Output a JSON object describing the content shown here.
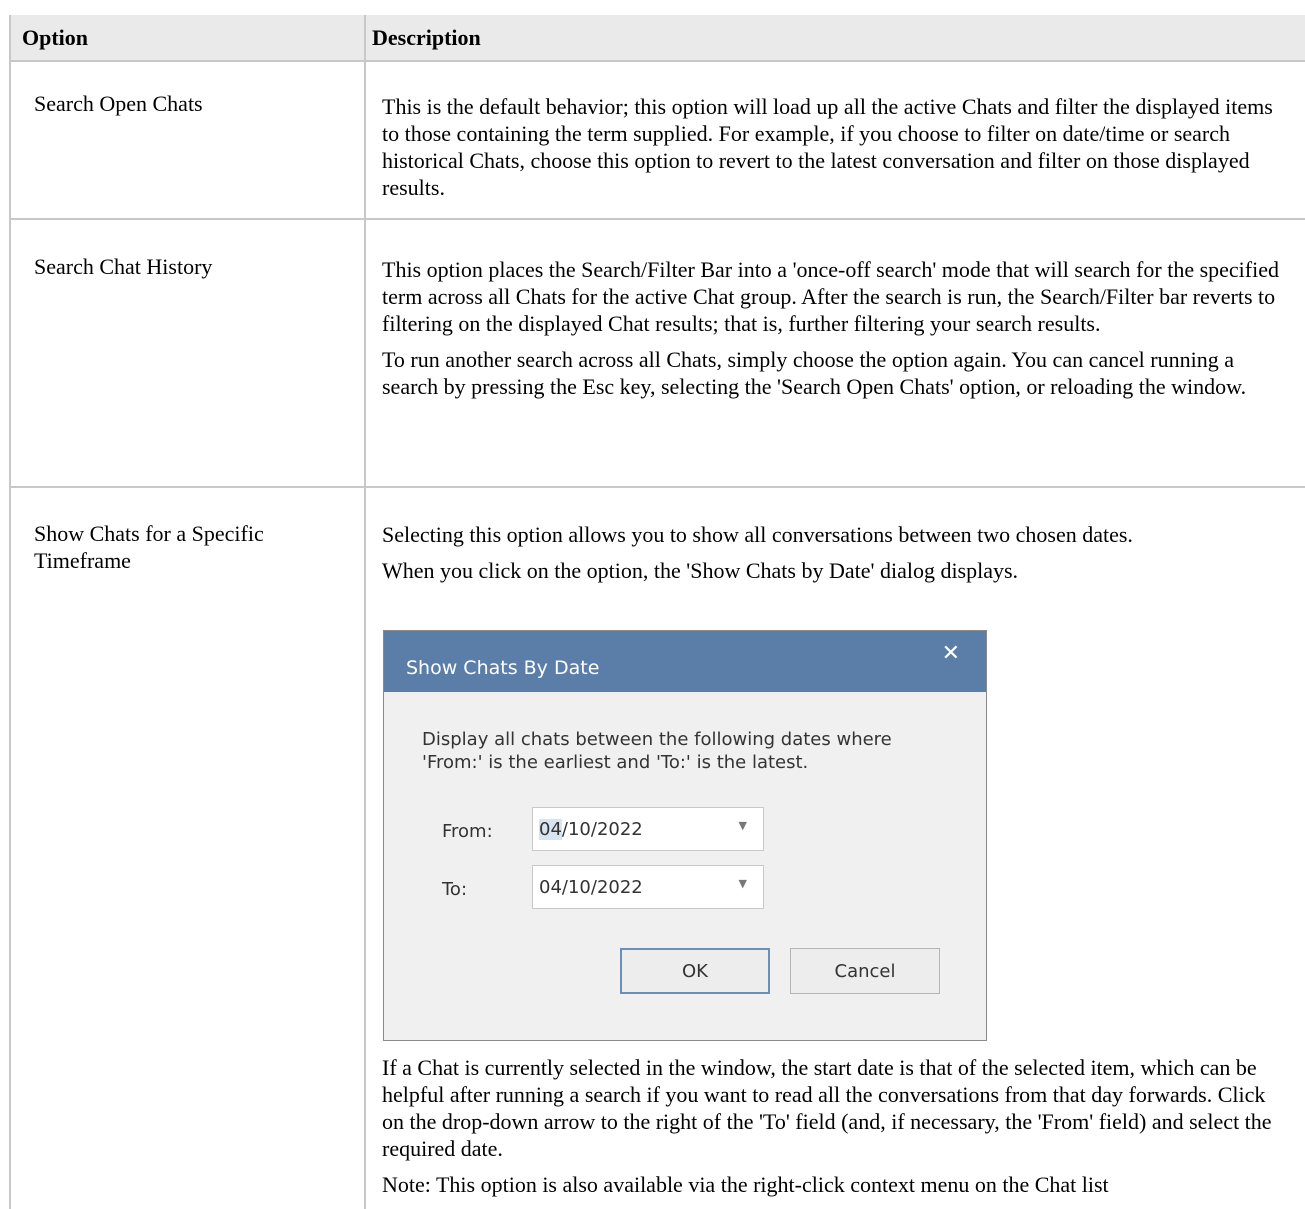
{
  "table": {
    "headers": {
      "option": "Option",
      "description": "Description"
    },
    "rows": [
      {
        "option": "Search Open Chats",
        "paragraphs": [
          "This is the default behavior; this option will load up all the active Chats and filter the displayed items to those containing the term supplied. For example, if you choose to filter on date/time or search historical Chats, choose this option to revert to the latest conversation and filter on those displayed results."
        ]
      },
      {
        "option": "Search Chat History",
        "paragraphs": [
          "This option places the Search/Filter Bar into a 'once-off search' mode that will search for the specified term across all Chats for the active Chat group. After the search is run, the Search/Filter bar reverts to filtering on the displayed Chat results; that is, further filtering your search results.",
          "To run another search across all Chats, simply choose the option again. You can cancel running a search by pressing the Esc key, selecting the 'Search Open Chats' option, or reloading the window."
        ]
      },
      {
        "option": "Show Chats for a Specific Timeframe",
        "paragraphs": [
          "Selecting this option allows you to show all conversations between two chosen dates.",
          "When you click on the option, the 'Show Chats by Date' dialog displays.",
          "If a Chat is currently selected in the window, the start date is that of the selected item, which can be helpful after running a search if you want to read all the conversations from that day forwards. Click on the drop-down arrow to the right of the 'To' field (and, if necessary, the 'From' field) and select the required date.",
          "Note: This option is also available via the right-click context menu on the Chat list"
        ]
      }
    ]
  },
  "dialog": {
    "title": "Show Chats By Date",
    "close_icon": "close-icon",
    "instruction_line1": "Display all chats between the following dates where",
    "instruction_line2": "'From:' is the earliest and 'To:' is the latest.",
    "from_label": "From:",
    "from_value_selected": "04",
    "from_value_rest": "/10/2022",
    "to_label": "To:",
    "to_value": "04/10/2022",
    "ok_label": "OK",
    "cancel_label": "Cancel",
    "colors": {
      "title_bar": "#5a7ea8",
      "body": "#f0f0f0"
    }
  }
}
